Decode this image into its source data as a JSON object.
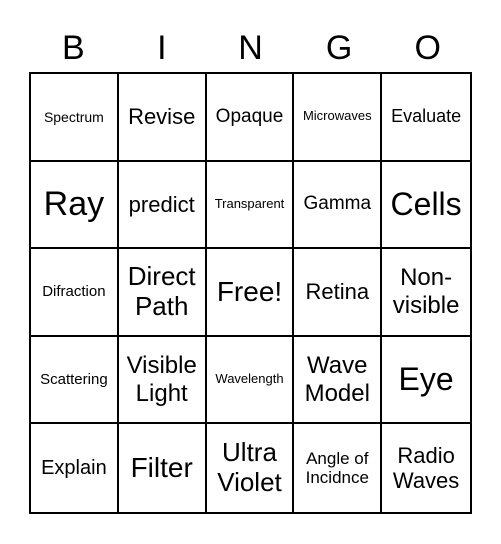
{
  "header": {
    "letters": [
      "B",
      "I",
      "N",
      "G",
      "O"
    ]
  },
  "board": {
    "rows": [
      [
        "Spectrum",
        "Revise",
        "Opaque",
        "Microwaves",
        "Evaluate"
      ],
      [
        "Ray",
        "predict",
        "Transparent",
        "Gamma",
        "Cells"
      ],
      [
        "Difraction",
        "Direct Path",
        "Free!",
        "Retina",
        "Non-visible"
      ],
      [
        "Scattering",
        "Visible Light",
        "Wavelength",
        "Wave Model",
        "Eye"
      ],
      [
        "Explain",
        "Filter",
        "Ultra Violet",
        "Angle of Incidnce",
        "Radio Waves"
      ]
    ]
  }
}
